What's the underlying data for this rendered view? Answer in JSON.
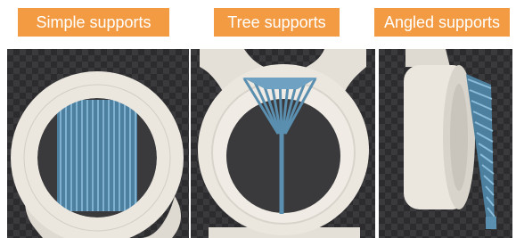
{
  "labels": {
    "simple": "Simple supports",
    "tree": "Tree supports",
    "angled": "Angled supports"
  },
  "colors": {
    "label_bg": "#f39b43",
    "label_text": "#ffffff",
    "model": "#e9e5dd",
    "support": "#5a8fb0",
    "background": "#3a3a3d"
  }
}
